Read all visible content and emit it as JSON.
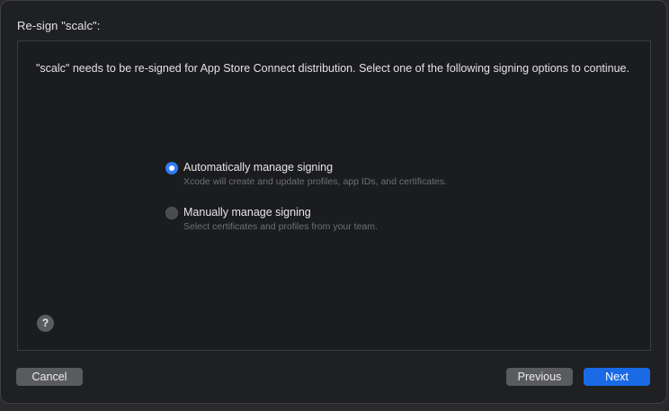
{
  "dialog": {
    "title": "Re-sign \"scalc\":",
    "description": "\"scalc\" needs to be re-signed for App Store Connect distribution. Select one of the following signing options to continue."
  },
  "options": [
    {
      "label": "Automatically manage signing",
      "description": "Xcode will create and update profiles, app IDs, and certificates.",
      "selected": true
    },
    {
      "label": "Manually manage signing",
      "description": "Select certificates and profiles from your team.",
      "selected": false
    }
  ],
  "help": {
    "label": "?"
  },
  "buttons": {
    "cancel": "Cancel",
    "previous": "Previous",
    "next": "Next"
  },
  "colors": {
    "accent": "#1a6ae6",
    "background": "#1f2022"
  }
}
